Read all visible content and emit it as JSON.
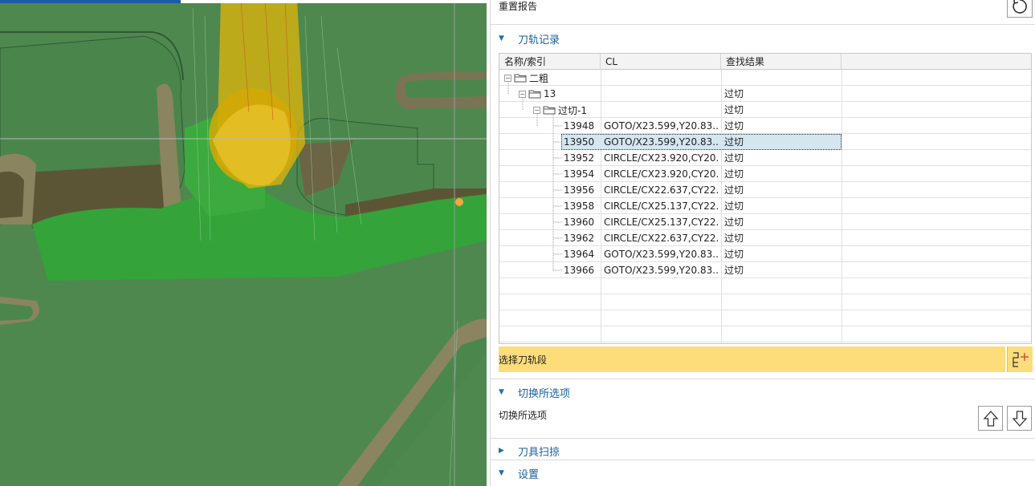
{
  "viewport": {
    "accent_colors": {
      "surface": "#3f9a3f",
      "wall": "#6b6545",
      "tool": "#e0b400",
      "marker": "#f5a742"
    }
  },
  "panel": {
    "reset": {
      "label": "重置报告",
      "icon": "reset-icon"
    },
    "toolpath_section": {
      "title": "刀轨记录",
      "columns": [
        "名称/索引",
        "CL",
        "查找结果"
      ],
      "tree": [
        {
          "label": "二粗",
          "result": ""
        },
        {
          "label": "13",
          "result": "过切"
        },
        {
          "label": "过切-1",
          "result": "过切"
        }
      ],
      "rows": [
        {
          "id": "13948",
          "cl": "GOTO/X23.599,Y20.83...",
          "result": "过切"
        },
        {
          "id": "13950",
          "cl": "GOTO/X23.599,Y20.83...",
          "result": "过切"
        },
        {
          "id": "13952",
          "cl": "CIRCLE/CX23.920,CY20...",
          "result": "过切"
        },
        {
          "id": "13954",
          "cl": "CIRCLE/CX23.920,CY20...",
          "result": "过切"
        },
        {
          "id": "13956",
          "cl": "CIRCLE/CX22.637,CY22...",
          "result": "过切"
        },
        {
          "id": "13958",
          "cl": "CIRCLE/CX25.137,CY22...",
          "result": "过切"
        },
        {
          "id": "13960",
          "cl": "CIRCLE/CX25.137,CY22...",
          "result": "过切"
        },
        {
          "id": "13962",
          "cl": "CIRCLE/CX22.637,CY22...",
          "result": "过切"
        },
        {
          "id": "13964",
          "cl": "GOTO/X23.599,Y20.83...",
          "result": "过切"
        },
        {
          "id": "13966",
          "cl": "GOTO/X23.599,Y20.83...",
          "result": "过切"
        }
      ],
      "selected_id": "13950",
      "select_label": "选择刀轨段"
    },
    "toggle_section": {
      "title": "切换所选项",
      "label": "切换所选项"
    },
    "sweep_section": {
      "title": "刀具扫掠"
    },
    "settings_section": {
      "title": "设置"
    }
  }
}
